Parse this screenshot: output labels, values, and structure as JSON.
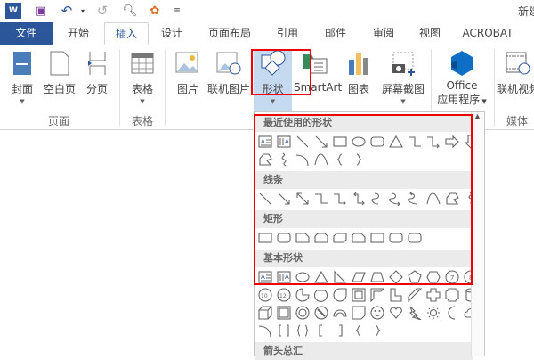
{
  "window": {
    "title": "新建"
  },
  "quick_access": [
    {
      "icon": "word-logo-icon"
    },
    {
      "icon": "save-icon"
    },
    {
      "icon": "undo-icon"
    },
    {
      "icon": "redo-icon"
    },
    {
      "icon": "print-preview-icon"
    },
    {
      "icon": "color-wheel-icon"
    },
    {
      "icon": "customize-icon"
    }
  ],
  "tabs": [
    "文件",
    "开始",
    "插入",
    "设计",
    "页面布局",
    "引用",
    "邮件",
    "审阅",
    "视图",
    "ACROBAT"
  ],
  "active_tab": "插入",
  "ribbon": {
    "cover": "封面",
    "blank_page": "空白页",
    "page_break": "分页",
    "group_pages": "页面",
    "table": "表格",
    "group_table": "表格",
    "picture": "图片",
    "online_picture": "联机图片",
    "shapes": "形状",
    "smartart": "SmartArt",
    "chart": "图表",
    "screenshot": "屏幕截图",
    "office_1": "Office",
    "office_2": "应用程序",
    "online_video": "联机视频",
    "group_media": "媒体"
  },
  "shapes_panel": {
    "sections": [
      {
        "title": "最近使用的形状",
        "rows": [
          [
            "textbox",
            "vtextbox",
            "line",
            "arrow",
            "rect",
            "ellipse",
            "roundrect",
            "triangle",
            "elbow",
            "elbowarrow",
            "rightarrow",
            "downarrow"
          ],
          [
            "freeform",
            "scribble",
            "arc",
            "wave",
            "lbrace",
            "rbrace"
          ]
        ]
      },
      {
        "title": "线条",
        "rows": [
          [
            "line",
            "arrow",
            "dblarrow",
            "elbow",
            "elbowarrow",
            "elbowdbl",
            "curve",
            "curvearrow",
            "curvedbl",
            "wave",
            "freeform",
            "scribble"
          ]
        ]
      },
      {
        "title": "矩形",
        "rows": [
          [
            "rect",
            "roundrect",
            "snip1",
            "snip2",
            "snipdiag",
            "sniprnd",
            "rect",
            "roundrect",
            "roundrect"
          ]
        ]
      },
      {
        "title": "基本形状",
        "rows": [
          [
            "textbox",
            "vtextbox",
            "ellipse",
            "triangle",
            "rtriangle",
            "parallelogram",
            "trapezoid",
            "diamond",
            "pentagon",
            "hexagon",
            "heptagon",
            "octagon"
          ],
          [
            "decagon",
            "dodecagon",
            "pie",
            "chord",
            "teardrop",
            "frame",
            "halfframe",
            "lshape",
            "diagstripe",
            "cross",
            "plaque",
            "can"
          ],
          [
            "cube",
            "bevel",
            "donut",
            "nosymbol",
            "blockarc",
            "foldedcorner",
            "smiley",
            "heart",
            "lightning",
            "sun",
            "moon",
            "cloud"
          ],
          [
            "arc",
            "brackets",
            "braces",
            "lbracket",
            "rbracket",
            "lbrace",
            "rbrace"
          ]
        ]
      },
      {
        "title": "箭头总汇",
        "rows": []
      }
    ]
  },
  "colors": {
    "file_tab": "#2b579a",
    "highlight": "#c5d9f1",
    "red": "#e00000"
  }
}
